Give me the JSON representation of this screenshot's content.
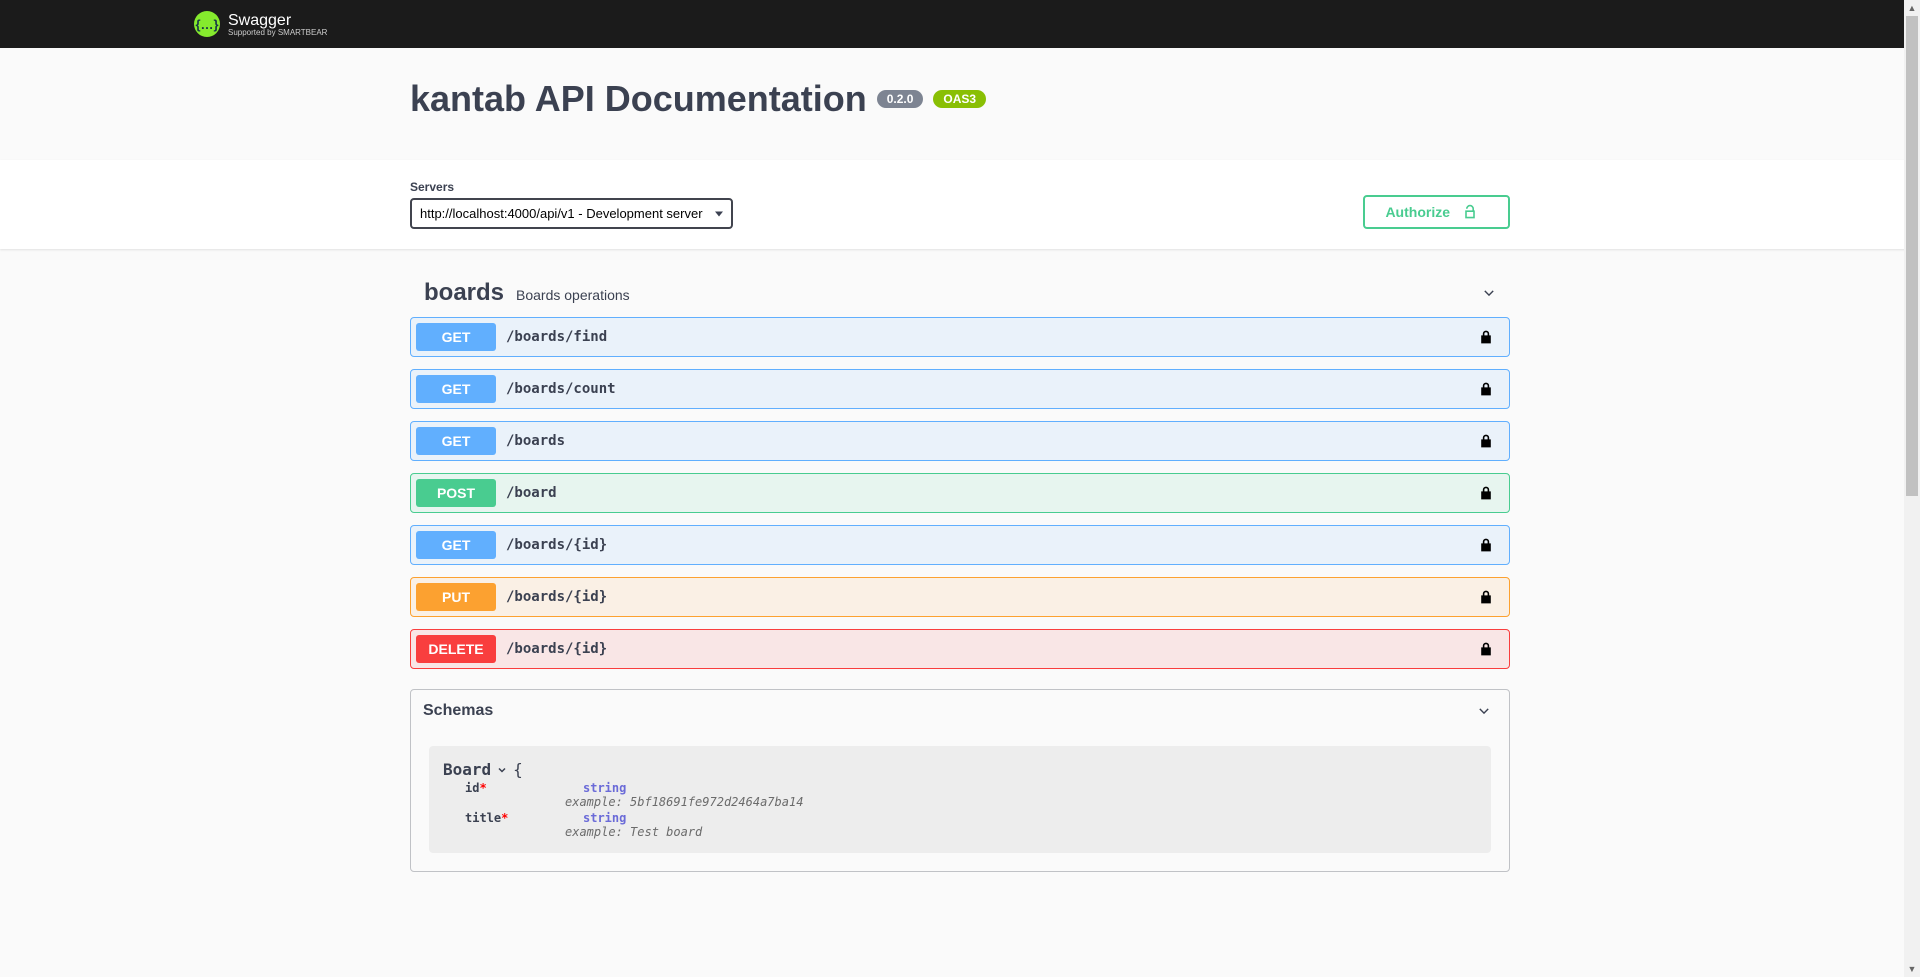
{
  "brand": {
    "name": "Swagger",
    "subtitle": "Supported by SMARTBEAR",
    "glyph": "{…}"
  },
  "info": {
    "title": "kantab API Documentation",
    "version": "0.2.0",
    "oas": "OAS3"
  },
  "servers": {
    "label": "Servers",
    "selected": "http://localhost:4000/api/v1 - Development server"
  },
  "authorize": "Authorize",
  "tag": {
    "name": "boards",
    "description": "Boards operations"
  },
  "operations": [
    {
      "method": "GET",
      "path": "/boards/find"
    },
    {
      "method": "GET",
      "path": "/boards/count"
    },
    {
      "method": "GET",
      "path": "/boards"
    },
    {
      "method": "POST",
      "path": "/board"
    },
    {
      "method": "GET",
      "path": "/boards/{id}"
    },
    {
      "method": "PUT",
      "path": "/boards/{id}"
    },
    {
      "method": "DELETE",
      "path": "/boards/{id}"
    }
  ],
  "schemas": {
    "title": "Schemas",
    "model": {
      "name": "Board",
      "props": [
        {
          "name": "id",
          "required": true,
          "type": "string",
          "example": "example: 5bf18691fe972d2464a7ba14"
        },
        {
          "name": "title",
          "required": true,
          "type": "string",
          "example": "example: Test board"
        }
      ]
    }
  }
}
